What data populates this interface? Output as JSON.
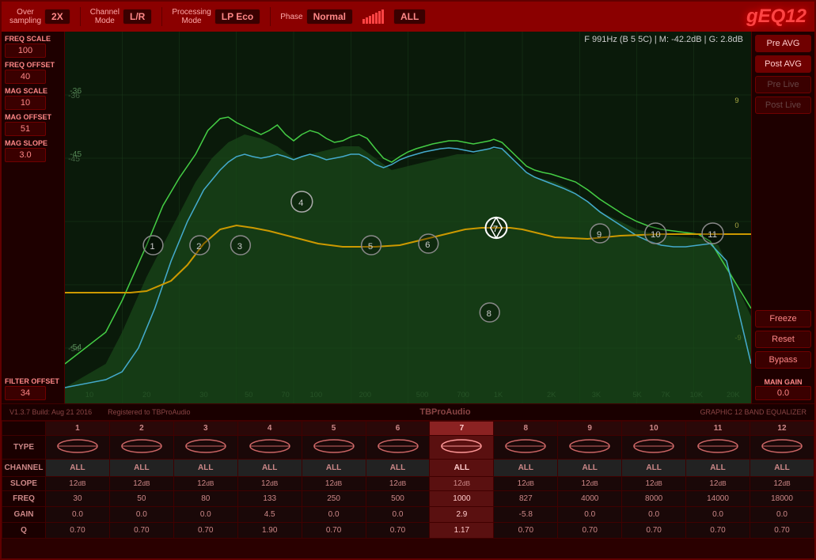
{
  "app": {
    "title": "gEQ12"
  },
  "topbar": {
    "oversampling_label": "Over\nsampling",
    "oversampling_value": "2X",
    "channel_mode_label": "Channel\nMode",
    "channel_mode_value": "L/R",
    "processing_mode_label": "Processing\nMode",
    "processing_mode_value": "LP Eco",
    "phase_label": "Phase",
    "phase_value": "Normal",
    "all_value": "ALL"
  },
  "eq_info": "F  991Hz (B 5 5C) | M: -42.2dB | G: 2.8dB",
  "left_params": [
    {
      "label": "FREQ SCALE",
      "value": "100"
    },
    {
      "label": "FREQ OFFSET",
      "value": "40"
    },
    {
      "label": "MAG SCALE",
      "value": "10"
    },
    {
      "label": "MAG OFFSET",
      "value": "51"
    },
    {
      "label": "MAG SLOPE",
      "value": "3.0"
    },
    {
      "label": "FILTER OFFSET",
      "value": "34"
    }
  ],
  "right_buttons": [
    {
      "id": "pre-avg",
      "label": "Pre AVG",
      "active": true
    },
    {
      "id": "post-avg",
      "label": "Post AVG",
      "active": true
    },
    {
      "id": "pre-live",
      "label": "Pre Live",
      "active": false,
      "dimmed": true
    },
    {
      "id": "post-live",
      "label": "Post Live",
      "active": false,
      "dimmed": true
    },
    {
      "id": "freeze",
      "label": "Freeze",
      "active": false
    },
    {
      "id": "reset",
      "label": "Reset",
      "active": false
    },
    {
      "id": "bypass",
      "label": "Bypass",
      "active": false
    }
  ],
  "main_gain_label": "MAIN GAIN",
  "main_gain_value": "0.0",
  "status": {
    "version": "V1.3.7 Build: Aug 21 2016",
    "registered": "Registered to TBProAudio",
    "brand": "TBProAudio",
    "product": "GRAPHIC 12 BAND EQUALIZER"
  },
  "bands": [
    {
      "num": "1",
      "selected": false,
      "type": "bell",
      "channel": "ALL",
      "slope": "12dB",
      "freq": "30",
      "gain": "0.0",
      "q": "0.70"
    },
    {
      "num": "2",
      "selected": false,
      "type": "bell",
      "channel": "ALL",
      "slope": "12dB",
      "freq": "50",
      "gain": "0.0",
      "q": "0.70"
    },
    {
      "num": "3",
      "selected": false,
      "type": "bell",
      "channel": "ALL",
      "slope": "12dB",
      "freq": "80",
      "gain": "0.0",
      "q": "0.70"
    },
    {
      "num": "4",
      "selected": false,
      "type": "bell",
      "channel": "ALL",
      "slope": "12dB",
      "freq": "133",
      "gain": "4.5",
      "q": "1.90"
    },
    {
      "num": "5",
      "selected": false,
      "type": "bell",
      "channel": "ALL",
      "slope": "12dB",
      "freq": "250",
      "gain": "0.0",
      "q": "0.70"
    },
    {
      "num": "6",
      "selected": false,
      "type": "bell",
      "channel": "ALL",
      "slope": "12dB",
      "freq": "500",
      "gain": "0.0",
      "q": "0.70"
    },
    {
      "num": "7",
      "selected": true,
      "type": "bell",
      "channel": "ALL",
      "slope": "12dB",
      "freq": "1000",
      "gain": "2.9",
      "q": "1.17"
    },
    {
      "num": "8",
      "selected": false,
      "type": "bell",
      "channel": "ALL",
      "slope": "12dB",
      "freq": "827",
      "gain": "-5.8",
      "q": "0.70"
    },
    {
      "num": "9",
      "selected": false,
      "type": "bell",
      "channel": "ALL",
      "slope": "12dB",
      "freq": "4000",
      "gain": "0.0",
      "q": "0.70"
    },
    {
      "num": "10",
      "selected": false,
      "type": "bell",
      "channel": "ALL",
      "slope": "12dB",
      "freq": "8000",
      "gain": "0.0",
      "q": "0.70"
    },
    {
      "num": "11",
      "selected": false,
      "type": "bell",
      "channel": "ALL",
      "slope": "12dB",
      "freq": "14000",
      "gain": "0.0",
      "q": "0.70"
    },
    {
      "num": "12",
      "selected": false,
      "type": "bell",
      "channel": "ALL",
      "slope": "12dB",
      "freq": "18000",
      "gain": "0.0",
      "q": "0.70"
    }
  ]
}
